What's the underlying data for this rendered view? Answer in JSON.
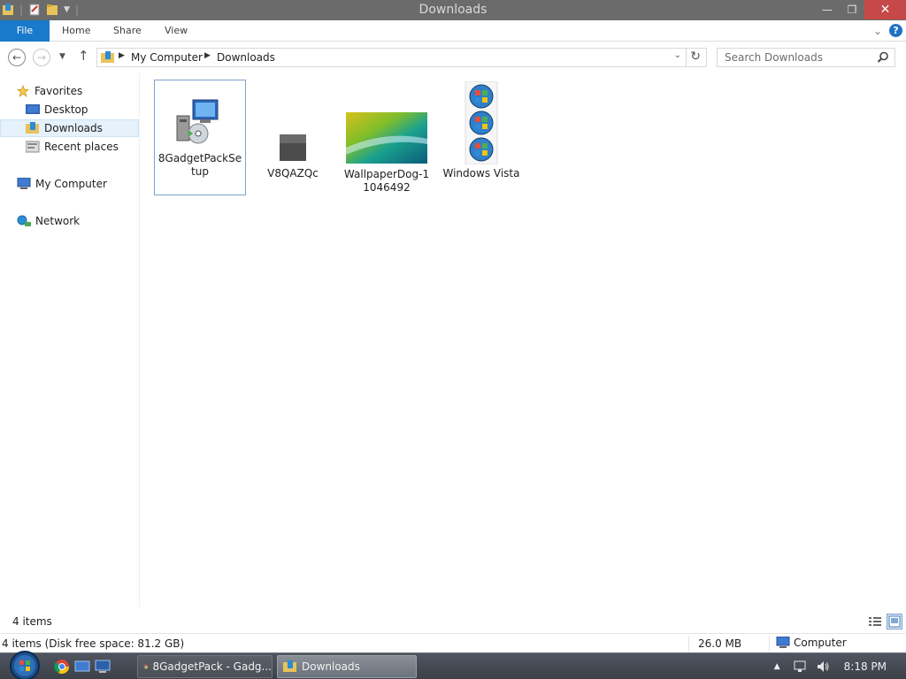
{
  "window": {
    "title": "Downloads"
  },
  "ribbon": {
    "file": "File",
    "home": "Home",
    "share": "Share",
    "view": "View"
  },
  "address": {
    "crumbs": [
      "My Computer",
      "Downloads"
    ]
  },
  "search": {
    "placeholder": "Search Downloads"
  },
  "navpane": {
    "favorites": "Favorites",
    "items": [
      "Desktop",
      "Downloads",
      "Recent places"
    ],
    "computer": "My Computer",
    "network": "Network"
  },
  "files": [
    {
      "name": "8GadgetPackSetup",
      "icon": "installer-icon",
      "selected": true
    },
    {
      "name": "V8QAZQc",
      "icon": "blank-file-icon"
    },
    {
      "name": "WallpaperDog-11046492",
      "icon": "wallpaper-thumbnail"
    },
    {
      "name": "Windows Vista",
      "icon": "windows-vista-orbs-thumbnail"
    }
  ],
  "status": {
    "count": "4 items"
  },
  "details": {
    "summary": "4 items (Disk free space: 81.2 GB)",
    "size": "26.0 MB",
    "location": "Computer"
  },
  "taskbar": {
    "buttons": [
      "8GadgetPack - Gadg...",
      "Downloads"
    ],
    "time": "8:18 PM"
  },
  "colors": {
    "accent": "#1979ca",
    "titlebar": "#6b6b6b",
    "close": "#c74848"
  }
}
